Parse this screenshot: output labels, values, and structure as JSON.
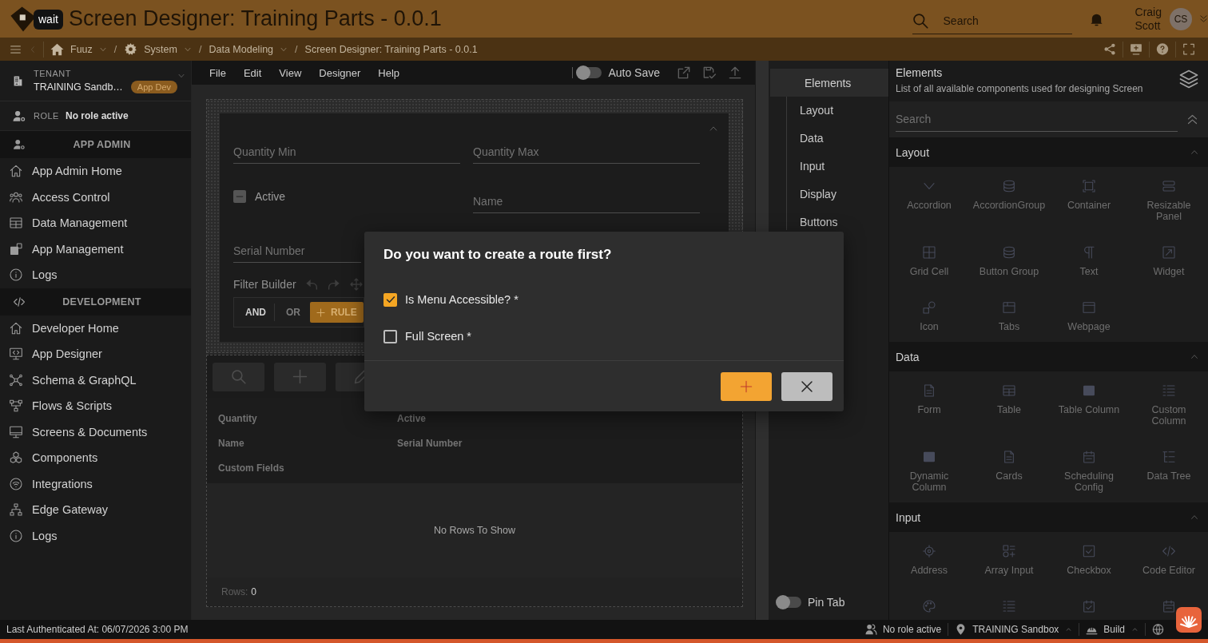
{
  "header": {
    "logo_tooltip": "wait",
    "title": "Screen Designer: Training Parts - 0.0.1",
    "search": {
      "placeholder": "Search"
    },
    "user": {
      "name": "Craig Scott",
      "initials": "CS"
    }
  },
  "breadcrumbs": [
    {
      "kind": "home",
      "label": "Fuuz",
      "dropdown": true
    },
    {
      "kind": "separator",
      "label": "/"
    },
    {
      "kind": "settings",
      "label": "System",
      "dropdown": true
    },
    {
      "kind": "separator",
      "label": "/"
    },
    {
      "kind": "plain",
      "label": "Data Modeling",
      "dropdown": true
    },
    {
      "kind": "separator",
      "label": "/"
    },
    {
      "kind": "plain",
      "label": "Screen Designer: Training Parts - 0.0.1",
      "dropdown": false
    }
  ],
  "sidebar": {
    "tenant": {
      "label": "TENANT",
      "name": "TRAINING Sandb…",
      "badge": "App Dev"
    },
    "role": {
      "label": "ROLE",
      "value": "No role active"
    },
    "sections": [
      {
        "title": "APP ADMIN",
        "kind": "admin",
        "items": [
          {
            "label": "App Admin Home",
            "kind": "home"
          },
          {
            "label": "Access Control",
            "kind": "users"
          },
          {
            "label": "Data Management",
            "kind": "table"
          },
          {
            "label": "App Management",
            "kind": "apps"
          },
          {
            "label": "Logs",
            "kind": "info"
          }
        ]
      },
      {
        "title": "DEVELOPMENT",
        "kind": "code",
        "items": [
          {
            "label": "Developer Home",
            "kind": "home"
          },
          {
            "label": "App Designer",
            "kind": "designer"
          },
          {
            "label": "Schema & GraphQL",
            "kind": "schema"
          },
          {
            "label": "Flows & Scripts",
            "kind": "flow"
          },
          {
            "label": "Screens & Documents",
            "kind": "screen"
          },
          {
            "label": "Components",
            "kind": "components"
          },
          {
            "label": "Integrations",
            "kind": "wifi"
          },
          {
            "label": "Edge Gateway",
            "kind": "network"
          },
          {
            "label": "Logs",
            "kind": "info"
          }
        ]
      }
    ]
  },
  "designer": {
    "menu": [
      "File",
      "Edit",
      "View",
      "Designer",
      "Help"
    ],
    "auto_save": {
      "label": "Auto Save",
      "on": false
    },
    "form": {
      "fields": [
        {
          "kind": "text",
          "placeholder": "Quantity Min"
        },
        {
          "kind": "text",
          "placeholder": "Quantity Max"
        },
        {
          "kind": "checkbox",
          "label": "Active",
          "indeterminate": true
        },
        {
          "kind": "text",
          "placeholder": "Name"
        },
        {
          "kind": "text",
          "placeholder": "Serial Number"
        }
      ],
      "filter_builder": {
        "label": "Filter Builder",
        "combinators": [
          {
            "label": "AND",
            "selected": true
          },
          {
            "label": "OR",
            "selected": false
          }
        ],
        "add_rule": "RULE"
      }
    },
    "table": {
      "tools": [
        {
          "kind": "search"
        },
        {
          "kind": "add"
        },
        {
          "kind": "edit"
        }
      ],
      "columns": [
        "Quantity",
        "Active",
        "Name",
        "Serial Number",
        "Custom Fields"
      ],
      "empty_message": "No Rows To Show",
      "row_count_label": "Rows:",
      "row_count": "0"
    }
  },
  "panel_tabs": {
    "title": "Elements",
    "items": [
      "Layout",
      "Data",
      "Input",
      "Display",
      "Buttons"
    ],
    "pin_tab": {
      "label": "Pin Tab",
      "on": false
    }
  },
  "elements": {
    "title": "Elements",
    "subtitle": "List of all available components used for designing Screen",
    "search": {
      "placeholder": "Search"
    },
    "sections": [
      {
        "title": "Layout",
        "expanded": true,
        "items": [
          {
            "label": "Accordion",
            "kind": "accordion"
          },
          {
            "label": "AccordionGroup",
            "kind": "stack"
          },
          {
            "label": "Container",
            "kind": "container"
          },
          {
            "label": "Resizable Panel",
            "kind": "panel"
          },
          {
            "label": "Grid Cell",
            "kind": "grid"
          },
          {
            "label": "Button Group",
            "kind": "stack"
          },
          {
            "label": "Text",
            "kind": "text"
          },
          {
            "label": "Widget",
            "kind": "widget"
          },
          {
            "label": "Icon",
            "kind": "shapes"
          },
          {
            "label": "Tabs",
            "kind": "tabs"
          },
          {
            "label": "Webpage",
            "kind": "browser"
          }
        ]
      },
      {
        "title": "Data",
        "expanded": true,
        "items": [
          {
            "label": "Form",
            "kind": "doc"
          },
          {
            "label": "Table",
            "kind": "table"
          },
          {
            "label": "Table Column",
            "kind": "window"
          },
          {
            "label": "Custom Column",
            "kind": "lines"
          },
          {
            "label": "Dynamic Column",
            "kind": "window"
          },
          {
            "label": "Cards",
            "kind": "doc"
          },
          {
            "label": "Scheduling Config",
            "kind": "calendar"
          },
          {
            "label": "Data Tree",
            "kind": "tree"
          }
        ]
      },
      {
        "title": "Input",
        "expanded": true,
        "items": [
          {
            "label": "Address",
            "kind": "target"
          },
          {
            "label": "Array Input",
            "kind": "array"
          },
          {
            "label": "Checkbox",
            "kind": "checkbox"
          },
          {
            "label": "Code Editor",
            "kind": "code"
          },
          {
            "kind": "palette"
          },
          {
            "kind": "lines"
          },
          {
            "kind": "calendar_check"
          },
          {
            "kind": "calendar"
          }
        ]
      }
    ]
  },
  "dialog": {
    "title": "Do you want to create a route first?",
    "options": [
      {
        "label": "Is Menu Accessible? *",
        "checked": true
      },
      {
        "label": "Full Screen *",
        "checked": false
      }
    ],
    "actions": [
      {
        "kind": "confirm"
      },
      {
        "kind": "cancel"
      }
    ]
  },
  "status_bar": {
    "last_authenticated": "Last Authenticated At: 06/07/2026 3:00 PM",
    "items": [
      {
        "kind": "role",
        "label": "No role active",
        "dropdown": false
      },
      {
        "kind": "tenant",
        "label": "TRAINING Sandbox",
        "dropdown": true
      },
      {
        "kind": "build",
        "label": "Build",
        "dropdown": true
      },
      {
        "kind": "language",
        "dropdown": false
      }
    ]
  }
}
